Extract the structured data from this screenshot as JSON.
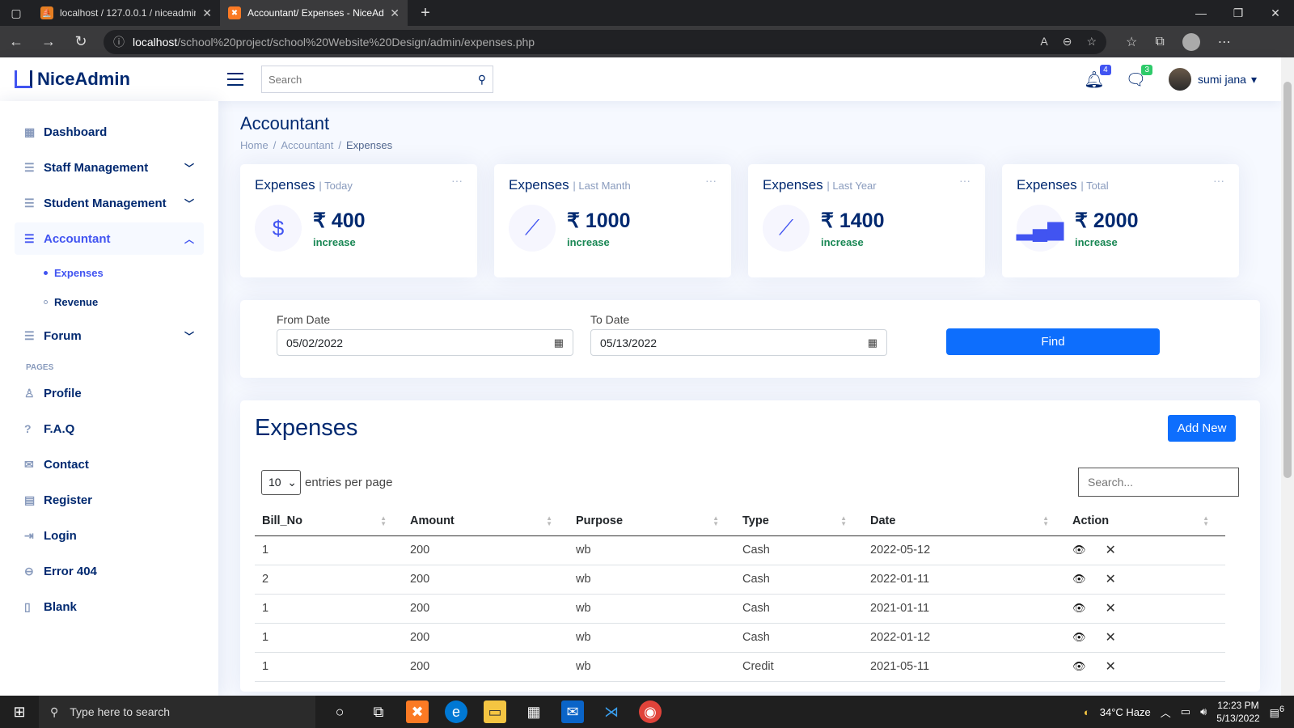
{
  "browser": {
    "tabs": [
      {
        "title": "localhost / 127.0.0.1 / niceadmin"
      },
      {
        "title": "Accountant/ Expenses - NiceAdmin"
      }
    ],
    "url_host": "localhost",
    "url_path": "/school%20project/school%20Website%20Design/admin/expenses.php"
  },
  "header": {
    "logo": "NiceAdmin",
    "search_placeholder": "Search",
    "notifications_count": "4",
    "messages_count": "3",
    "user_name": "sumi jana"
  },
  "sidebar": {
    "items": [
      {
        "label": "Dashboard"
      },
      {
        "label": "Staff Management"
      },
      {
        "label": "Student Management"
      },
      {
        "label": "Accountant"
      },
      {
        "label": "Forum"
      }
    ],
    "subitems": [
      {
        "label": "Expenses"
      },
      {
        "label": "Revenue"
      }
    ],
    "pages_heading": "PAGES",
    "pages": [
      {
        "label": "Profile"
      },
      {
        "label": "F.A.Q"
      },
      {
        "label": "Contact"
      },
      {
        "label": "Register"
      },
      {
        "label": "Login"
      },
      {
        "label": "Error 404"
      },
      {
        "label": "Blank"
      }
    ]
  },
  "main": {
    "title": "Accountant",
    "breadcrumb": [
      "Home",
      "Accountant",
      "Expenses"
    ],
    "cards": [
      {
        "title": "Expenses",
        "sub": "| Today",
        "value": "₹ 400",
        "change": "increase"
      },
      {
        "title": "Expenses",
        "sub": "| Last Manth",
        "value": "₹ 1000",
        "change": "increase"
      },
      {
        "title": "Expenses",
        "sub": "| Last Year",
        "value": "₹ 1400",
        "change": "increase"
      },
      {
        "title": "Expenses",
        "sub": "| Total",
        "value": "₹ 2000",
        "change": "increase"
      }
    ],
    "filter": {
      "from_label": "From Date",
      "from_value": "05/02/2022",
      "to_label": "To Date",
      "to_value": "05/13/2022",
      "find_label": "Find"
    },
    "table": {
      "title": "Expenses",
      "add_label": "Add New",
      "per_page": "10",
      "per_page_label": "entries per page",
      "search_placeholder": "Search...",
      "columns": [
        "Bill_No",
        "Amount",
        "Purpose",
        "Type",
        "Date",
        "Action"
      ],
      "rows": [
        [
          "1",
          "200",
          "wb",
          "Cash",
          "2022-05-12"
        ],
        [
          "2",
          "200",
          "wb",
          "Cash",
          "2022-01-11"
        ],
        [
          "1",
          "200",
          "wb",
          "Cash",
          "2021-01-11"
        ],
        [
          "1",
          "200",
          "wb",
          "Cash",
          "2022-01-12"
        ],
        [
          "1",
          "200",
          "wb",
          "Credit",
          "2021-05-11"
        ]
      ]
    }
  },
  "taskbar": {
    "search_placeholder": "Type here to search",
    "weather": "34°C  Haze",
    "time": "12:23 PM",
    "date": "5/13/2022",
    "notif_count": "6"
  },
  "colors": {
    "accent": "#4154f1",
    "navy": "#012970",
    "primary_btn": "#0d6efd",
    "increase": "#198754"
  }
}
